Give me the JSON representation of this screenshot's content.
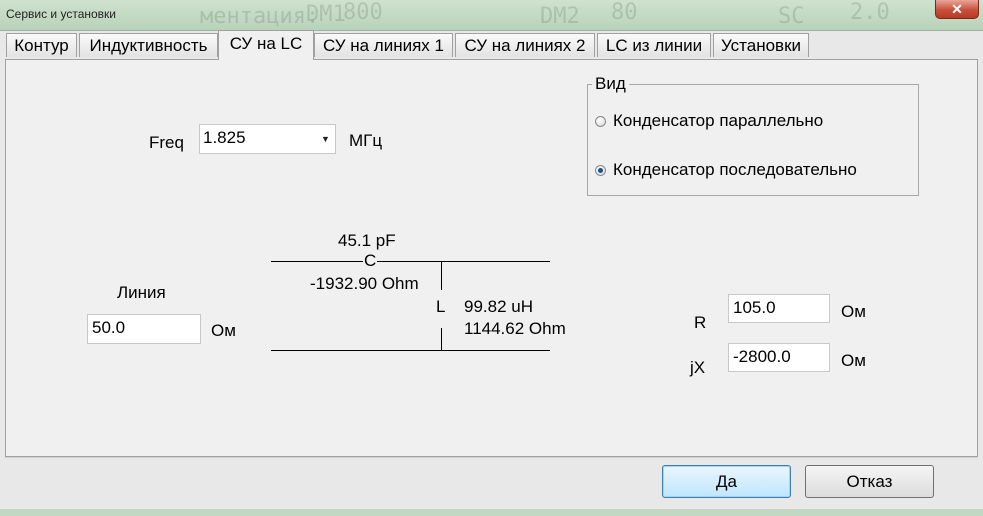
{
  "window": {
    "title": "Сервис и установки",
    "background_text": [
      "ментация:",
      "DM1",
      "800",
      "DM2",
      "80",
      "SC",
      "2.0"
    ],
    "close_glyph": "✕"
  },
  "tabs": [
    {
      "label": "Контур",
      "active": false
    },
    {
      "label": "Индуктивность",
      "active": false
    },
    {
      "label": "СУ на LC",
      "active": true
    },
    {
      "label": "СУ на линиях 1",
      "active": false
    },
    {
      "label": "СУ на линиях 2",
      "active": false
    },
    {
      "label": "LC из линии",
      "active": false
    },
    {
      "label": "Установки",
      "active": false
    }
  ],
  "freq": {
    "label": "Freq",
    "value": "1.825",
    "unit": "МГц",
    "arrow_icon": "dropdown-arrow"
  },
  "view_group": {
    "title": "Вид",
    "options": [
      {
        "label": "Конденсатор параллельно",
        "checked": false
      },
      {
        "label": "Конденсатор последовательно",
        "checked": true
      }
    ]
  },
  "line": {
    "label": "Линия",
    "value": "50.0",
    "unit": "Ом"
  },
  "circuit": {
    "c_value": "45.1 pF",
    "c_label": "C",
    "c_reactance": "-1932.90 Ohm",
    "l_label": "L",
    "l_value": "99.82 uH",
    "l_reactance": "1144.62 Ohm"
  },
  "load": {
    "r_label": "R",
    "r_value": "105.0",
    "r_unit": "Ом",
    "jx_label": "jX",
    "jx_value": "-2800.0",
    "jx_unit": "Ом"
  },
  "buttons": {
    "ok": "Да",
    "cancel": "Отказ"
  },
  "colors": {
    "titlebar": "#c2d8c2",
    "close": "#c9503c",
    "default_button": "#bee6fd",
    "radio_dot": "#1f4e8c"
  }
}
